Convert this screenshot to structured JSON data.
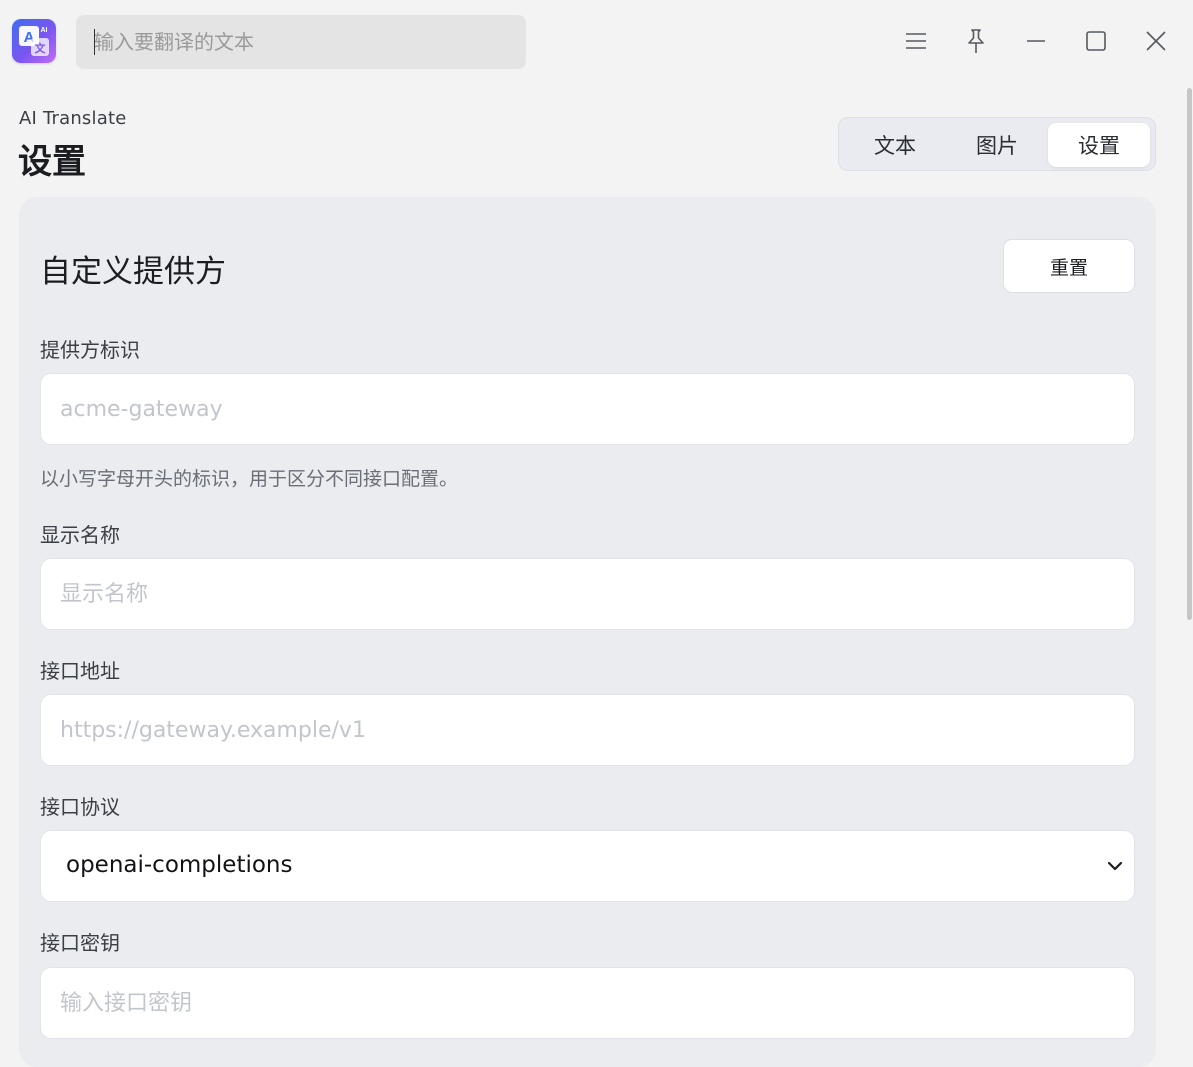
{
  "titlebar": {
    "search_placeholder": "输入要翻译的文本"
  },
  "header": {
    "app_name": "AI Translate",
    "page_title": "设置"
  },
  "tabs": [
    {
      "label": "文本",
      "active": false
    },
    {
      "label": "图片",
      "active": false
    },
    {
      "label": "设置",
      "active": true
    }
  ],
  "section": {
    "title": "自定义提供方",
    "reset_label": "重置"
  },
  "fields": {
    "provider_id": {
      "label": "提供方标识",
      "placeholder": "acme-gateway",
      "hint": "以小写字母开头的标识，用于区分不同接口配置。"
    },
    "display_name": {
      "label": "显示名称",
      "placeholder": "显示名称"
    },
    "endpoint": {
      "label": "接口地址",
      "placeholder": "https://gateway.example/v1"
    },
    "protocol": {
      "label": "接口协议",
      "value": "openai-completions"
    },
    "api_key": {
      "label": "接口密钥",
      "placeholder": "输入接口密钥"
    }
  },
  "icons": {
    "app": "translate-icon",
    "menu": "menu-icon",
    "pin": "pin-icon",
    "minimize": "minimize-icon",
    "maximize": "maximize-icon",
    "close": "close-icon",
    "chevron": "chevron-down-icon"
  },
  "colors": {
    "background": "#f3f3f3",
    "card": "#ebecf0",
    "accent_gradient_start": "#3f6df2",
    "accent_gradient_end": "#c06df5"
  }
}
